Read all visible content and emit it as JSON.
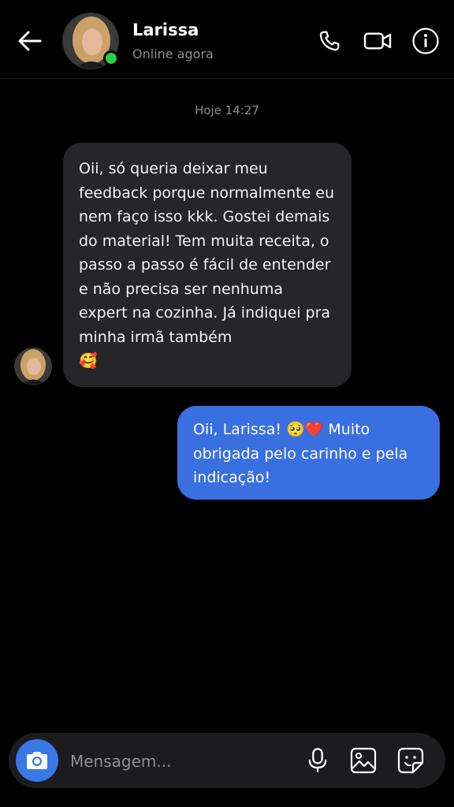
{
  "header": {
    "contact_name": "Larissa",
    "status": "Online agora",
    "icons": [
      "back-arrow-icon",
      "phone-icon",
      "video-camera-icon",
      "info-icon"
    ]
  },
  "chat": {
    "timestamp": "Hoje 14:27",
    "messages": [
      {
        "direction": "incoming",
        "text": "Oii, só queria deixar meu feedback porque normalmente eu nem faço isso kkk. Gostei demais do material! Tem muita receita, o passo a passo é fácil de entender e não precisa ser nenhuma expert na cozinha. Já indiquei pra minha irmã também",
        "emoji": "🥰"
      },
      {
        "direction": "outgoing",
        "text_before": "Oii, Larissa! ",
        "emoji": "🥺❤️",
        "text_after": " Muito obrigada pelo carinho e pela indicação!"
      }
    ]
  },
  "composer": {
    "placeholder": "Mensagem...",
    "icons": [
      "camera-icon",
      "microphone-icon",
      "image-icon",
      "sticker-icon"
    ]
  },
  "colors": {
    "background": "#000000",
    "incoming_bubble": "#262628",
    "outgoing_bubble": "#3a6fe0",
    "camera_button": "#3a78e6",
    "online_dot": "#2ecc40",
    "muted_text": "#8e8e93"
  }
}
